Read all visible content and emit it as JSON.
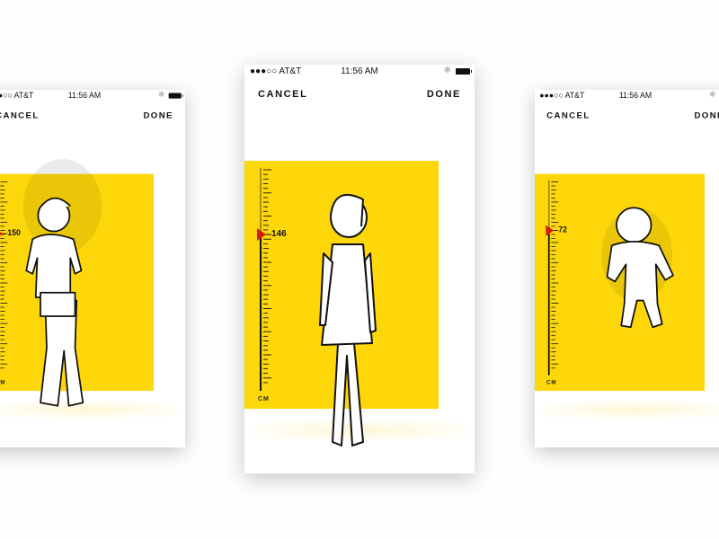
{
  "phones": [
    {
      "status": {
        "carrier": "●●●○○ AT&T",
        "time": "11:56 AM"
      },
      "nav": {
        "cancel": "CANCEL",
        "done": "DONE"
      },
      "ruler": {
        "unit": "CM",
        "value": "150",
        "figure": "boy"
      }
    },
    {
      "status": {
        "carrier": "●●●○○ AT&T",
        "time": "11:56 AM"
      },
      "nav": {
        "cancel": "CANCEL",
        "done": "DONE"
      },
      "ruler": {
        "unit": "CM",
        "value": "146",
        "figure": "girl"
      }
    },
    {
      "status": {
        "carrier": "●●●○○ AT&T",
        "time": "11:56 AM"
      },
      "nav": {
        "cancel": "CANCEL",
        "done": "DONE"
      },
      "ruler": {
        "unit": "CM",
        "value": "72",
        "figure": "baby"
      }
    }
  ],
  "colors": {
    "accent": "#fed70a",
    "marker": "#d71d0e"
  }
}
